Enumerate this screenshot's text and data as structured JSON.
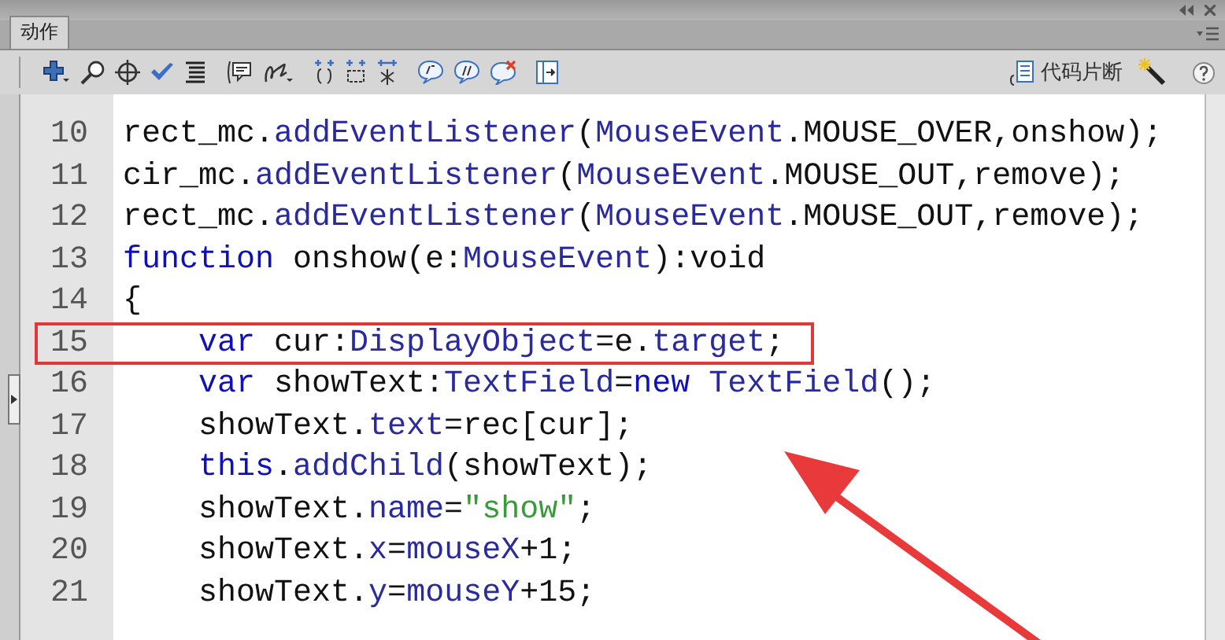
{
  "tabs": [
    {
      "label": "动作",
      "selected": true
    }
  ],
  "toolbar": {
    "snippets_button": {
      "label": "代码片断"
    }
  },
  "editor": {
    "lines": [
      {
        "number": "10",
        "boxed": false,
        "indented": false,
        "tokens": [
          {
            "kind": "plain",
            "text": "rect_mc."
          },
          {
            "kind": "api",
            "text": "addEventListener"
          },
          {
            "kind": "plain",
            "text": "("
          },
          {
            "kind": "api",
            "text": "MouseEvent"
          },
          {
            "kind": "plain",
            "text": ".MOUSE_OVER,onshow);"
          }
        ]
      },
      {
        "number": "11",
        "boxed": false,
        "indented": false,
        "tokens": [
          {
            "kind": "plain",
            "text": "cir_mc."
          },
          {
            "kind": "api",
            "text": "addEventListener"
          },
          {
            "kind": "plain",
            "text": "("
          },
          {
            "kind": "api",
            "text": "MouseEvent"
          },
          {
            "kind": "plain",
            "text": ".MOUSE_OUT,remove);"
          }
        ]
      },
      {
        "number": "12",
        "boxed": false,
        "indented": false,
        "tokens": [
          {
            "kind": "plain",
            "text": "rect_mc."
          },
          {
            "kind": "api",
            "text": "addEventListener"
          },
          {
            "kind": "plain",
            "text": "("
          },
          {
            "kind": "api",
            "text": "MouseEvent"
          },
          {
            "kind": "plain",
            "text": ".MOUSE_OUT,remove);"
          }
        ]
      },
      {
        "number": "13",
        "boxed": false,
        "indented": false,
        "tokens": [
          {
            "kind": "keyword",
            "text": "function"
          },
          {
            "kind": "plain",
            "text": " onshow(e:"
          },
          {
            "kind": "api",
            "text": "MouseEvent"
          },
          {
            "kind": "plain",
            "text": "):void"
          }
        ]
      },
      {
        "number": "14",
        "boxed": false,
        "indented": false,
        "tokens": [
          {
            "kind": "plain",
            "text": "{"
          }
        ]
      },
      {
        "number": "15",
        "boxed": true,
        "indented": true,
        "tokens": [
          {
            "kind": "keyword",
            "text": "var"
          },
          {
            "kind": "plain",
            "text": " cur:"
          },
          {
            "kind": "api",
            "text": "DisplayObject"
          },
          {
            "kind": "plain",
            "text": "=e."
          },
          {
            "kind": "api",
            "text": "target"
          },
          {
            "kind": "plain",
            "text": ";"
          }
        ]
      },
      {
        "number": "16",
        "boxed": false,
        "indented": true,
        "tokens": [
          {
            "kind": "keyword",
            "text": "var"
          },
          {
            "kind": "plain",
            "text": " showText:"
          },
          {
            "kind": "api",
            "text": "TextField"
          },
          {
            "kind": "plain",
            "text": "="
          },
          {
            "kind": "keyword",
            "text": "new"
          },
          {
            "kind": "api",
            "text": " TextField"
          },
          {
            "kind": "plain",
            "text": "();"
          }
        ]
      },
      {
        "number": "17",
        "boxed": false,
        "indented": true,
        "tokens": [
          {
            "kind": "plain",
            "text": "showText."
          },
          {
            "kind": "api",
            "text": "text"
          },
          {
            "kind": "plain",
            "text": "=rec[cur];"
          }
        ]
      },
      {
        "number": "18",
        "boxed": false,
        "indented": true,
        "tokens": [
          {
            "kind": "keyword",
            "text": "this"
          },
          {
            "kind": "plain",
            "text": "."
          },
          {
            "kind": "api",
            "text": "addChild"
          },
          {
            "kind": "plain",
            "text": "(showText);"
          }
        ]
      },
      {
        "number": "19",
        "boxed": false,
        "indented": true,
        "tokens": [
          {
            "kind": "plain",
            "text": "showText."
          },
          {
            "kind": "api",
            "text": "name"
          },
          {
            "kind": "plain",
            "text": "="
          },
          {
            "kind": "string",
            "text": "\"show\""
          },
          {
            "kind": "plain",
            "text": ";"
          }
        ]
      },
      {
        "number": "20",
        "boxed": false,
        "indented": true,
        "tokens": [
          {
            "kind": "plain",
            "text": "showText."
          },
          {
            "kind": "api",
            "text": "x"
          },
          {
            "kind": "plain",
            "text": "="
          },
          {
            "kind": "api",
            "text": "mouseX"
          },
          {
            "kind": "plain",
            "text": "+1;"
          }
        ]
      },
      {
        "number": "21",
        "boxed": false,
        "indented": true,
        "tokens": [
          {
            "kind": "plain",
            "text": "showText."
          },
          {
            "kind": "api",
            "text": "y"
          },
          {
            "kind": "plain",
            "text": "="
          },
          {
            "kind": "api",
            "text": "mouseY"
          },
          {
            "kind": "plain",
            "text": "+15;"
          }
        ]
      }
    ]
  }
}
